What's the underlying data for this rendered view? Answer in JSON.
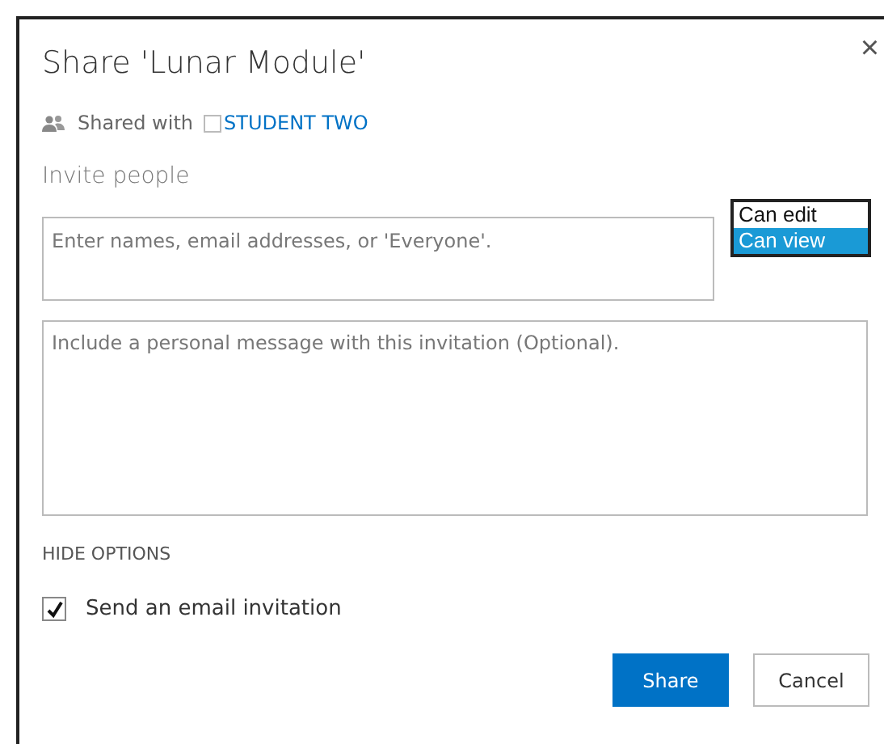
{
  "dialog": {
    "title": "Share 'Lunar Module'",
    "close": "×"
  },
  "shared_with": {
    "label": "Shared with",
    "checked": false,
    "name": "STUDENT TWO"
  },
  "invite": {
    "label": "Invite people",
    "placeholder": "Enter names, email addresses, or 'Everyone'."
  },
  "permissions": [
    {
      "label": "Can edit",
      "selected": false
    },
    {
      "label": "Can view",
      "selected": true
    }
  ],
  "message": {
    "placeholder": "Include a personal message with this invitation (Optional)."
  },
  "options_toggle": "HIDE OPTIONS",
  "email_invitation": {
    "label": "Send an email invitation",
    "checked": true
  },
  "buttons": [
    {
      "label": "Share",
      "kind": "primary"
    },
    {
      "label": "Cancel",
      "kind": "secondary"
    }
  ]
}
